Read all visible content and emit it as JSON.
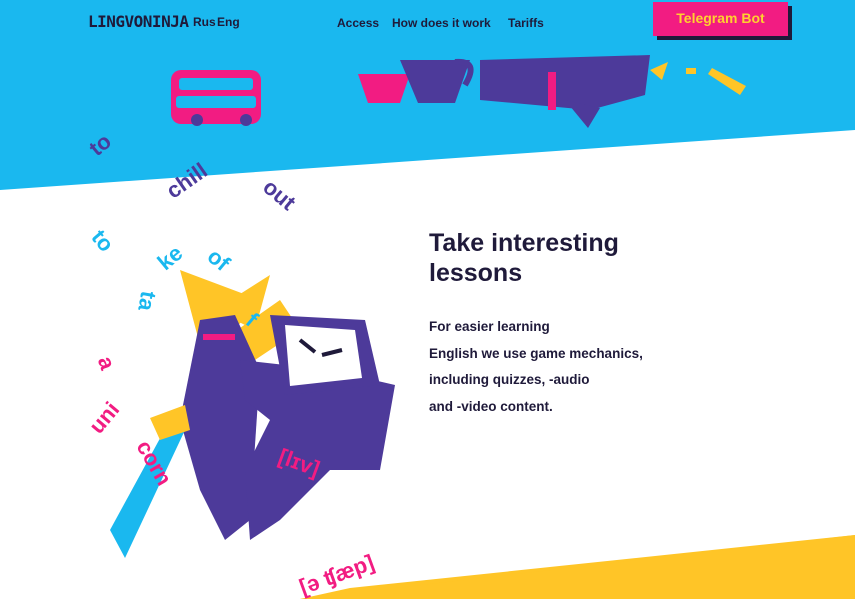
{
  "header": {
    "logo": "LINGVONINJA",
    "lang_rus": "Rus",
    "lang_eng": "Eng",
    "nav": [
      "Access",
      "How does it work",
      "Tariffs"
    ],
    "telegram_button": "Telegram Bot"
  },
  "main": {
    "title": "Take interesting lessons",
    "description_lines": [
      "For easier learning",
      "English we use game mechanics,",
      "including quizzes, -audio",
      "and -video content."
    ]
  },
  "floating_words": {
    "to_1": "to",
    "chill": "chill",
    "out": "out",
    "to_2": "to",
    "ke": "ke",
    "of": "of",
    "ta": "ta",
    "f": "f",
    "a": "a",
    "uni": "uni",
    "corn": "corn",
    "ipa_1": "[lɪv]",
    "ipa_2": "[ə ʧæp]"
  },
  "colors": {
    "blue": "#1ab8ef",
    "pink": "#f21c82",
    "yellow": "#ffc527",
    "navy": "#1f1a3a",
    "purple": "#4d3a9a"
  }
}
